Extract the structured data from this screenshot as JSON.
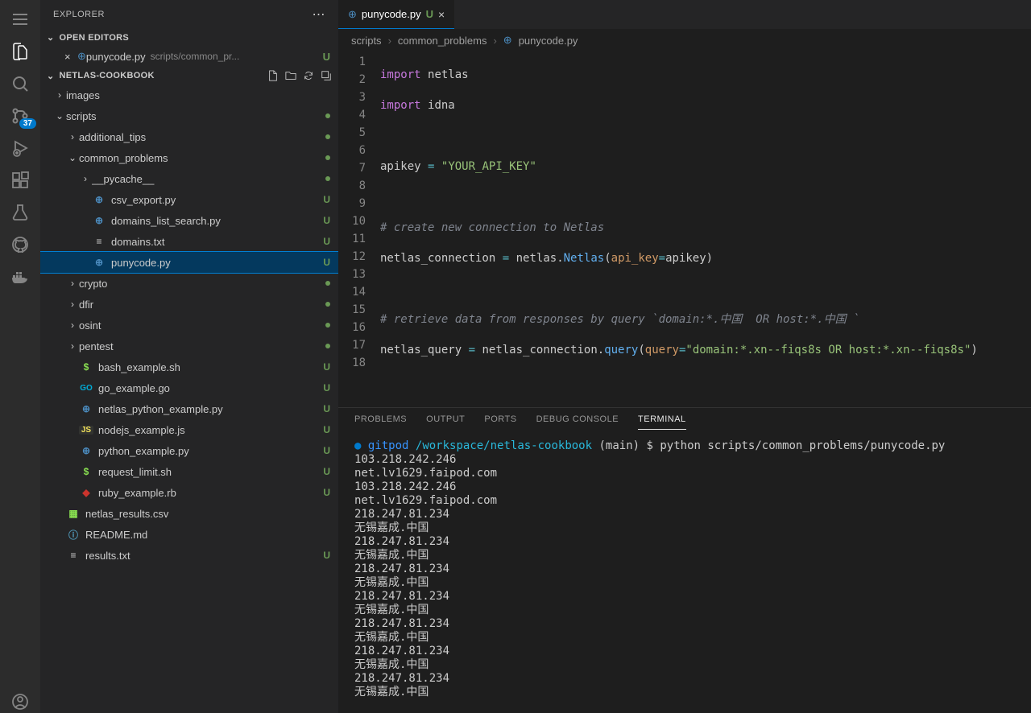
{
  "activity_bar": {
    "scm_badge": "37"
  },
  "sidebar": {
    "title": "EXPLORER",
    "open_editors_label": "OPEN EDITORS",
    "open_editor": {
      "name": "punycode.py",
      "path": "scripts/common_pr...",
      "status": "U"
    },
    "project_label": "NETLAS-COOKBOOK",
    "tree": {
      "images": "images",
      "scripts": "scripts",
      "additional_tips": "additional_tips",
      "common_problems": "common_problems",
      "pycache": "__pycache__",
      "csv_export": "csv_export.py",
      "domains_list": "domains_list_search.py",
      "domains_txt": "domains.txt",
      "punycode": "punycode.py",
      "crypto": "crypto",
      "dfir": "dfir",
      "osint": "osint",
      "pentest": "pentest",
      "bash_example": "bash_example.sh",
      "go_example": "go_example.go",
      "netlas_py": "netlas_python_example.py",
      "nodejs": "nodejs_example.js",
      "python_ex": "python_example.py",
      "request_limit": "request_limit.sh",
      "ruby_ex": "ruby_example.rb",
      "netlas_csv": "netlas_results.csv",
      "readme": "README.md",
      "results": "results.txt"
    },
    "status_u": "U"
  },
  "tab": {
    "name": "punycode.py",
    "modified": "U"
  },
  "breadcrumb": {
    "a": "scripts",
    "b": "common_problems",
    "c": "punycode.py"
  },
  "code": {
    "lines": [
      "1",
      "2",
      "3",
      "4",
      "5",
      "6",
      "7",
      "8",
      "9",
      "10",
      "11",
      "12",
      "13",
      "14",
      "15",
      "16",
      "17",
      "18"
    ]
  },
  "panel": {
    "tabs": {
      "problems": "PROBLEMS",
      "output": "OUTPUT",
      "ports": "PORTS",
      "debug": "DEBUG CONSOLE",
      "terminal": "TERMINAL"
    }
  },
  "terminal": {
    "user": "gitpod",
    "path": "/workspace/netlas-cookbook",
    "branch": "(main)",
    "cmd": "$ python scripts/common_problems/punycode.py",
    "output": [
      "103.218.242.246",
      "net.lv1629.faipod.com",
      "103.218.242.246",
      "net.lv1629.faipod.com",
      "218.247.81.234",
      "无锡嘉成.中国",
      "218.247.81.234",
      "无锡嘉成.中国",
      "218.247.81.234",
      "无锡嘉成.中国",
      "218.247.81.234",
      "无锡嘉成.中国",
      "218.247.81.234",
      "无锡嘉成.中国",
      "218.247.81.234",
      "无锡嘉成.中国",
      "218.247.81.234",
      "无锡嘉成.中国"
    ]
  }
}
